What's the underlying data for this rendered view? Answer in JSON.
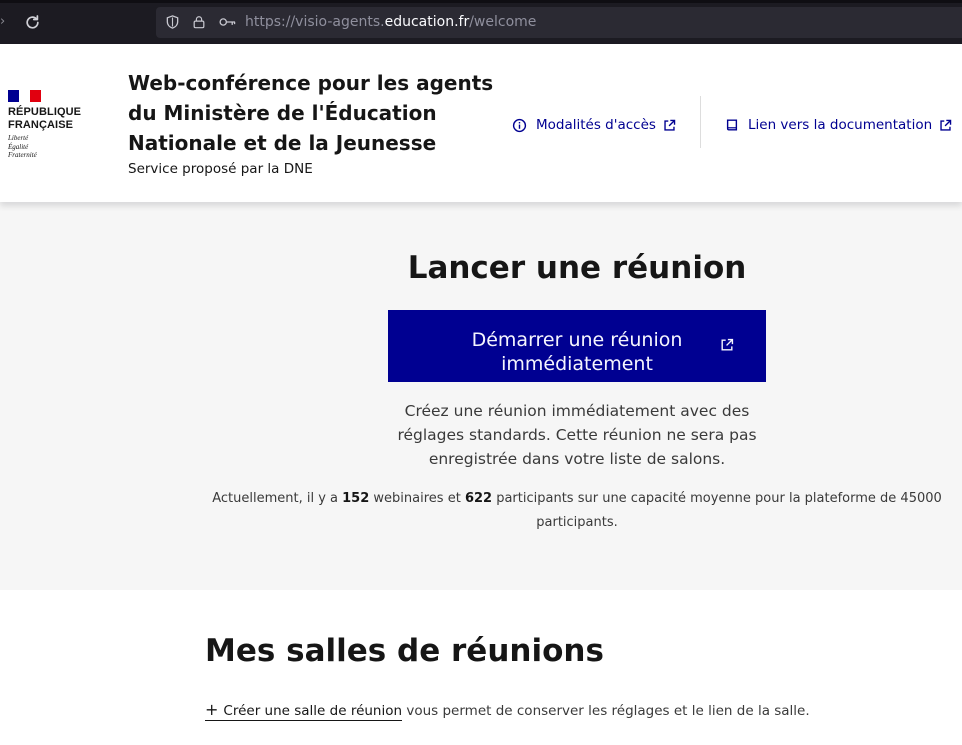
{
  "browser": {
    "url_prefix": "https://visio-agents.",
    "url_host": "education.fr",
    "url_path": "/welcome"
  },
  "header": {
    "logo_lines": [
      "RÉPUBLIQUE",
      "FRANÇAISE"
    ],
    "logo_motto": [
      "Liberté",
      "Égalité",
      "Fraternité"
    ],
    "title": "Web-conférence pour les agents du Ministère de l'Éducation Nationale et de la Jeunesse",
    "subtitle": "Service proposé par la DNE",
    "links": {
      "access": "Modalités d'accès",
      "documentation": "Lien vers la documentation"
    }
  },
  "hero": {
    "title": "Lancer une réunion",
    "start_button": "Démarrer une réunion immédiatement",
    "description": "Créez une réunion immédiatement avec des réglages standards. Cette réunion ne sera pas enregistrée dans votre liste de salons.",
    "stats": {
      "prefix": "Actuellement, il y a",
      "webinars": "152",
      "middle": "webinaires et",
      "participants": "622",
      "suffix": "participants sur une capacité moyenne pour la plateforme de 45000 participants."
    }
  },
  "rooms": {
    "title": "Mes salles de réunions",
    "create_link": "Créer une salle de réunion",
    "create_suffix": "vous permet de conserver les réglages et le lien de la salle."
  },
  "colors": {
    "primary": "#000091",
    "hero_bg": "#f6f6f6",
    "flag_blue": "#000091",
    "flag_red": "#e1000f"
  },
  "icons": [
    "arrow-icon",
    "reload-icon",
    "shield-icon",
    "lock-icon",
    "key-icon",
    "info-icon",
    "external-link-icon",
    "book-icon",
    "plus-icon"
  ]
}
